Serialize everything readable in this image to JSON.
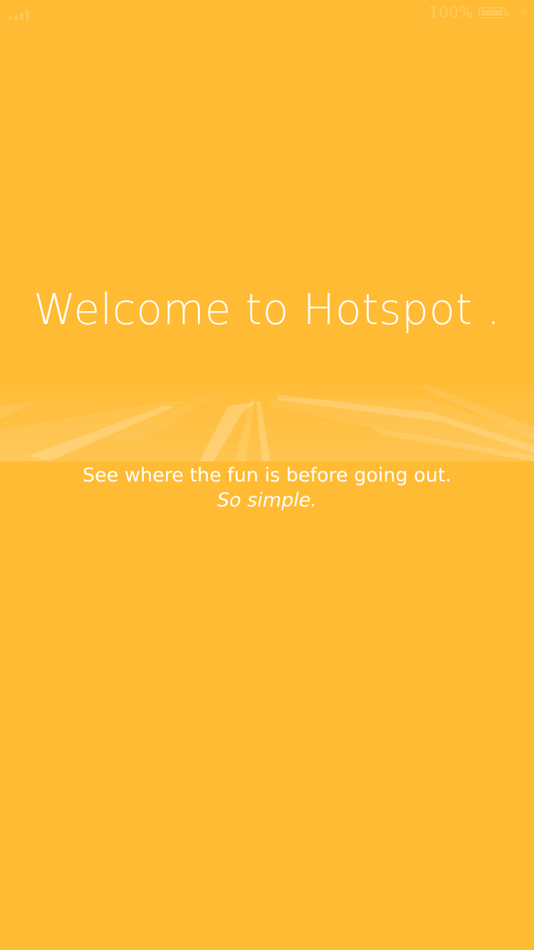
{
  "status_bar": {
    "battery_percent": "100%",
    "bolt_glyph": "⚡"
  },
  "welcome": {
    "title": "Welcome to Hotspot .",
    "tagline": "See where the fun is before going out.",
    "tagline_emphasis": "So simple."
  },
  "colors": {
    "background": "#FFBB33",
    "text": "#FFFFFF"
  },
  "icons": {
    "signal": "signal-icon",
    "battery": "battery-icon",
    "charging": "charging-bolt-icon"
  }
}
